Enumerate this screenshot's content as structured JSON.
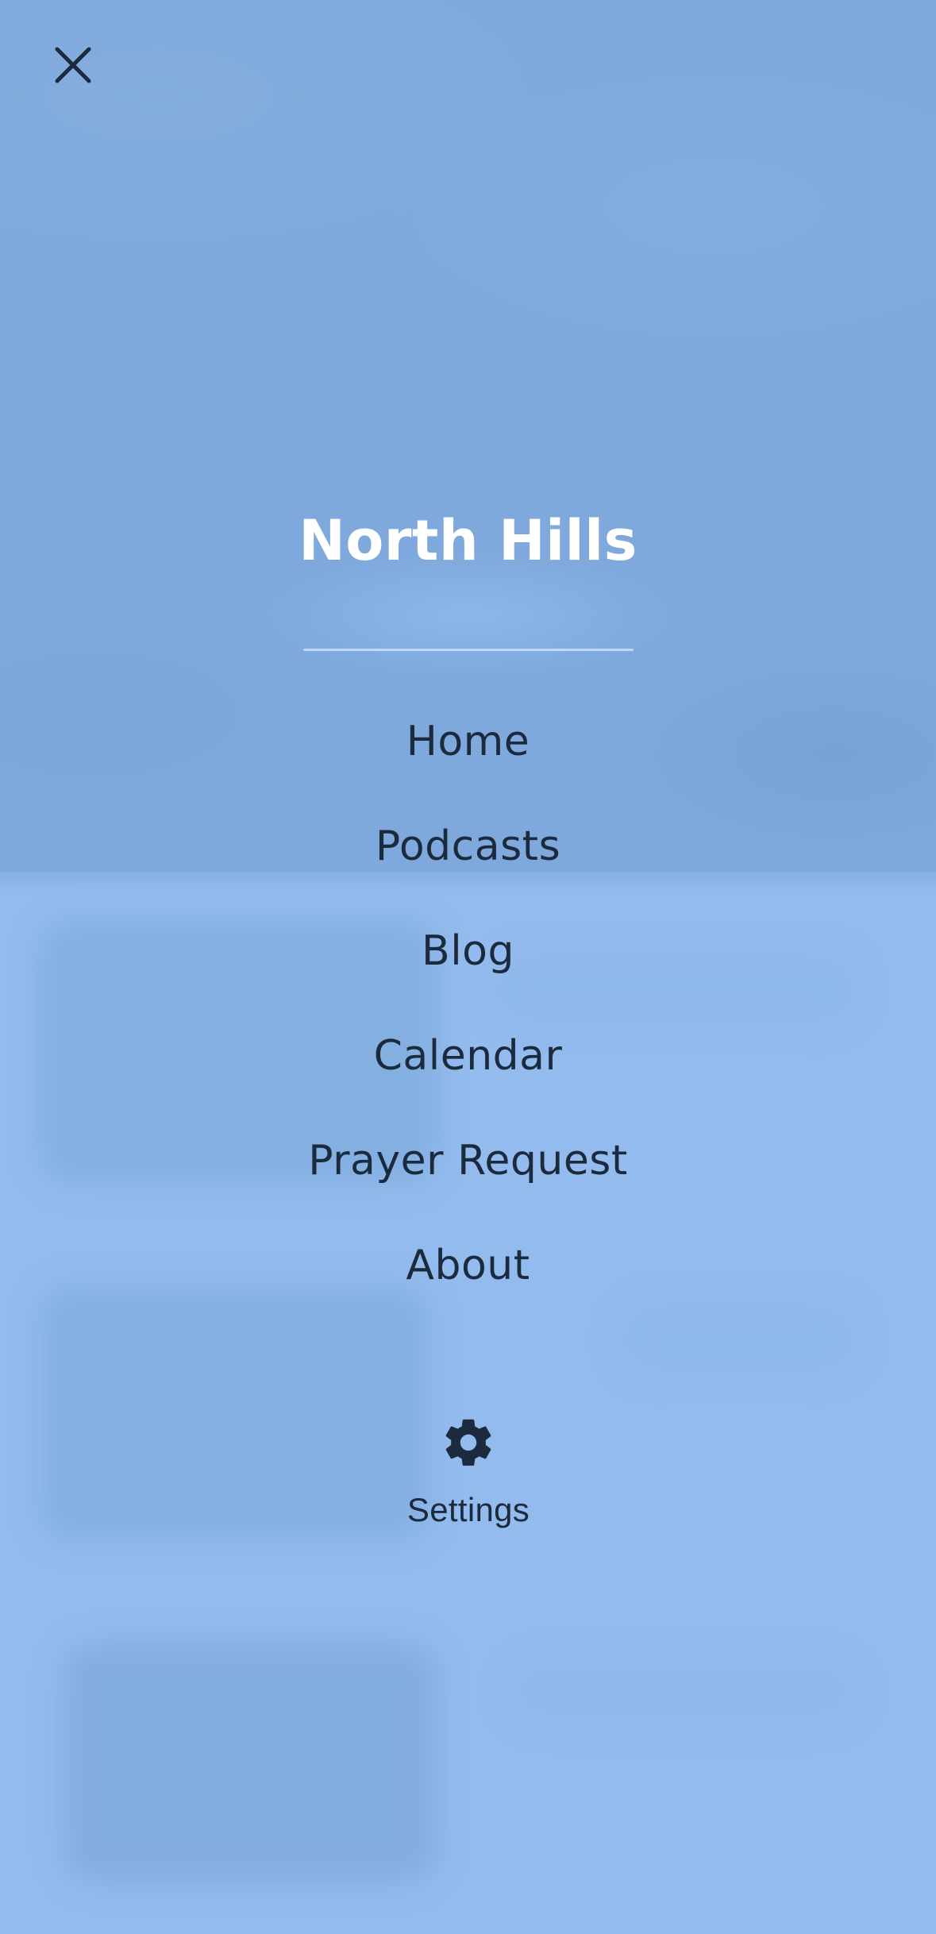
{
  "menu": {
    "close_icon": "close-icon",
    "brand_title": "North Hills",
    "items": [
      {
        "label": "Home"
      },
      {
        "label": "Podcasts"
      },
      {
        "label": "Blog"
      },
      {
        "label": "Calendar"
      },
      {
        "label": "Prayer Request"
      },
      {
        "label": "About"
      }
    ],
    "settings": {
      "icon": "gear-icon",
      "label": "Settings"
    }
  },
  "colors": {
    "overlay_top": "#7fa9dc",
    "overlay_bottom": "#93bbee",
    "text_dark": "#1b2a3d",
    "title": "#ffffff"
  }
}
